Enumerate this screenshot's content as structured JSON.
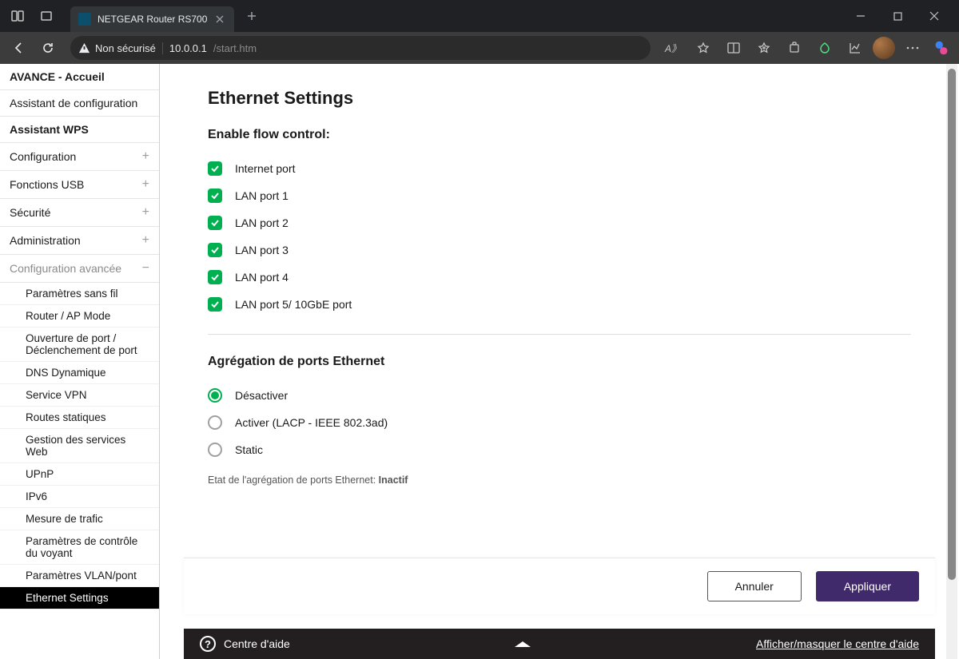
{
  "browser": {
    "tab_title": "NETGEAR Router RS700",
    "security_label": "Non sécurisé",
    "url_host": "10.0.0.1",
    "url_path": "/start.htm"
  },
  "sidebar": {
    "items": [
      {
        "label": "AVANCE - Accueil"
      },
      {
        "label": "Assistant de configuration"
      },
      {
        "label": "Assistant WPS"
      },
      {
        "label": "Configuration"
      },
      {
        "label": "Fonctions USB"
      },
      {
        "label": "Sécurité"
      },
      {
        "label": "Administration"
      },
      {
        "label": "Configuration avancée"
      }
    ],
    "sub": [
      {
        "label": "Paramètres sans fil"
      },
      {
        "label": "Router / AP Mode"
      },
      {
        "label": "Ouverture de port / Déclenchement de port"
      },
      {
        "label": "DNS Dynamique"
      },
      {
        "label": "Service VPN"
      },
      {
        "label": "Routes statiques"
      },
      {
        "label": "Gestion des services Web"
      },
      {
        "label": "UPnP"
      },
      {
        "label": "IPv6"
      },
      {
        "label": "Mesure de trafic"
      },
      {
        "label": "Paramètres de contrôle du voyant"
      },
      {
        "label": "Paramètres VLAN/pont"
      },
      {
        "label": "Ethernet Settings"
      }
    ]
  },
  "main": {
    "page_title": "Ethernet Settings",
    "flow_control_heading": "Enable flow control:",
    "ports": [
      {
        "label": "Internet port"
      },
      {
        "label": "LAN port 1"
      },
      {
        "label": "LAN port 2"
      },
      {
        "label": "LAN port 3"
      },
      {
        "label": "LAN port 4"
      },
      {
        "label": "LAN port 5/ 10GbE port"
      }
    ],
    "aggregation_heading": "Agrégation de ports Ethernet",
    "agg_options": [
      {
        "label": "Désactiver"
      },
      {
        "label": "Activer (LACP - IEEE 802.3ad)"
      },
      {
        "label": "Static"
      }
    ],
    "status_prefix": "Etat de l'agrégation de ports Ethernet: ",
    "status_value": "Inactif",
    "cancel_label": "Annuler",
    "apply_label": "Appliquer"
  },
  "helpbar": {
    "title": "Centre d'aide",
    "toggle": "Afficher/masquer le centre d'aide"
  }
}
